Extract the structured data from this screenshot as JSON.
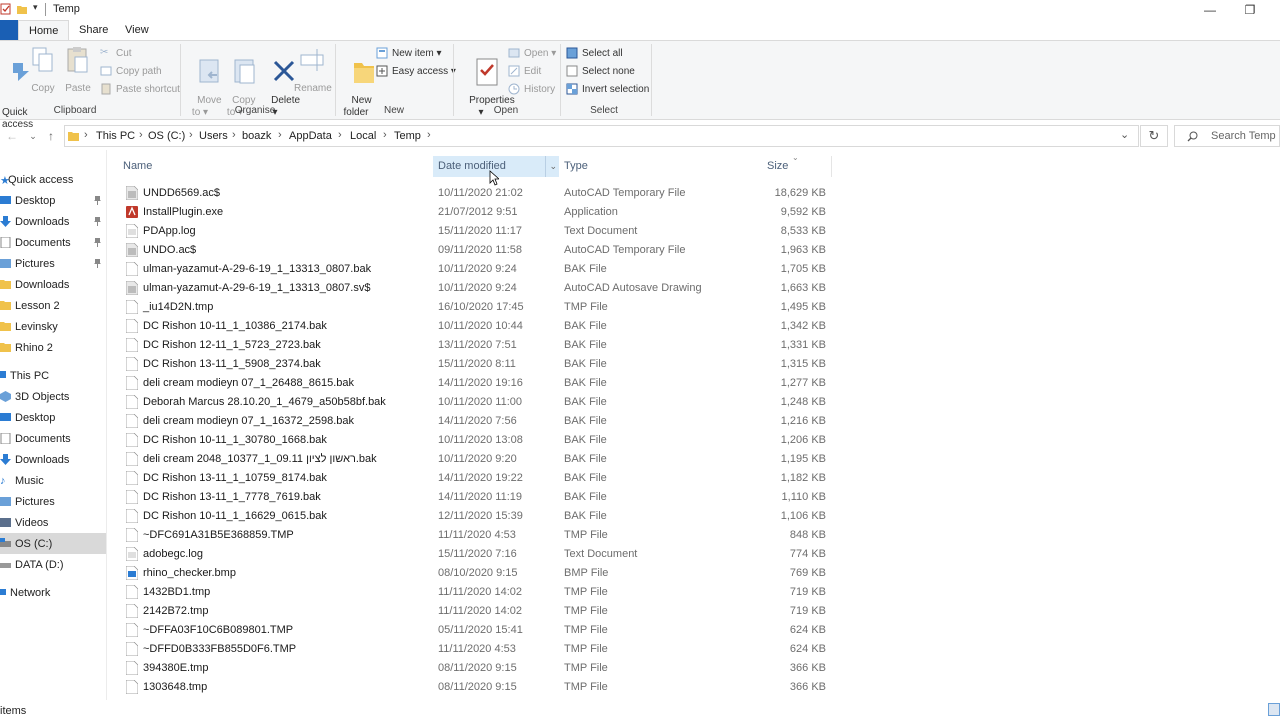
{
  "window": {
    "title": "Temp",
    "controls": [
      "—",
      "❐"
    ]
  },
  "tabs": [
    "Home",
    "Share",
    "View"
  ],
  "ribbon": {
    "clipboard": {
      "label": "Clipboard",
      "quick_access": "Quick\naccess",
      "copy": "Copy",
      "paste": "Paste",
      "cut": "Cut",
      "copy_path": "Copy path",
      "paste_shortcut": "Paste shortcut"
    },
    "organise": {
      "label": "Organise",
      "move_to": "Move\nto ▾",
      "copy_to": "Copy\nto ▾",
      "delete": "Delete\n▾",
      "rename": "Rename"
    },
    "new": {
      "label": "New",
      "new_folder": "New\nfolder",
      "new_item": "New item ▾",
      "easy_access": "Easy access ▾"
    },
    "open": {
      "label": "Open",
      "properties": "Properties\n▾",
      "open": "Open ▾",
      "edit": "Edit",
      "history": "History"
    },
    "select": {
      "label": "Select",
      "select_all": "Select all",
      "select_none": "Select none",
      "invert_selection": "Invert selection"
    }
  },
  "address": {
    "crumbs": [
      "This PC",
      "OS (C:)",
      "Users",
      "boazk",
      "AppData",
      "Local",
      "Temp"
    ],
    "separator": "›",
    "search_placeholder": "Search Temp"
  },
  "nav": {
    "quick_access": "Quick access",
    "pinned": [
      "Desktop",
      "Downloads",
      "Documents",
      "Pictures"
    ],
    "recent": [
      "Downloads",
      "Lesson 2",
      "Levinsky",
      "Rhino 2"
    ],
    "this_pc": "This PC",
    "pc_items": [
      "3D Objects",
      "Desktop",
      "Documents",
      "Downloads",
      "Music",
      "Pictures",
      "Videos",
      "OS (C:)",
      "DATA (D:)"
    ],
    "network": "Network"
  },
  "columns": {
    "name": "Name",
    "date": "Date modified",
    "type": "Type",
    "size": "Size"
  },
  "files": [
    {
      "name": "UNDD6569.ac$",
      "date": "10/11/2020 21:02",
      "type": "AutoCAD Temporary File",
      "size": "18,629 KB",
      "icon": "acad"
    },
    {
      "name": "InstallPlugin.exe",
      "date": "21/07/2012 9:51",
      "type": "Application",
      "size": "9,592 KB",
      "icon": "exe"
    },
    {
      "name": "PDApp.log",
      "date": "15/11/2020 11:17",
      "type": "Text Document",
      "size": "8,533 KB",
      "icon": "text"
    },
    {
      "name": "UNDO.ac$",
      "date": "09/11/2020 11:58",
      "type": "AutoCAD Temporary File",
      "size": "1,963 KB",
      "icon": "acad"
    },
    {
      "name": "ulman-yazamut-A-29-6-19_1_13313_0807.bak",
      "date": "10/11/2020 9:24",
      "type": "BAK File",
      "size": "1,705 KB",
      "icon": "blank"
    },
    {
      "name": "ulman-yazamut-A-29-6-19_1_13313_0807.sv$",
      "date": "10/11/2020 9:24",
      "type": "AutoCAD Autosave Drawing",
      "size": "1,663 KB",
      "icon": "acad"
    },
    {
      "name": "_iu14D2N.tmp",
      "date": "16/10/2020 17:45",
      "type": "TMP File",
      "size": "1,495 KB",
      "icon": "blank"
    },
    {
      "name": "DC Rishon 10-11_1_10386_2174.bak",
      "date": "10/11/2020 10:44",
      "type": "BAK File",
      "size": "1,342 KB",
      "icon": "blank"
    },
    {
      "name": "DC Rishon 12-11_1_5723_2723.bak",
      "date": "13/11/2020 7:51",
      "type": "BAK File",
      "size": "1,331 KB",
      "icon": "blank"
    },
    {
      "name": "DC Rishon 13-11_1_5908_2374.bak",
      "date": "15/11/2020 8:11",
      "type": "BAK File",
      "size": "1,315 KB",
      "icon": "blank"
    },
    {
      "name": "deli cream modieyn 07_1_26488_8615.bak",
      "date": "14/11/2020 19:16",
      "type": "BAK File",
      "size": "1,277 KB",
      "icon": "blank"
    },
    {
      "name": "Deborah Marcus 28.10.20_1_4679_a50b58bf.bak",
      "date": "10/11/2020 11:00",
      "type": "BAK File",
      "size": "1,248 KB",
      "icon": "blank"
    },
    {
      "name": "deli cream modieyn 07_1_16372_2598.bak",
      "date": "14/11/2020 7:56",
      "type": "BAK File",
      "size": "1,216 KB",
      "icon": "blank"
    },
    {
      "name": "DC Rishon 10-11_1_30780_1668.bak",
      "date": "10/11/2020 13:08",
      "type": "BAK File",
      "size": "1,206 KB",
      "icon": "blank"
    },
    {
      "name": "deli cream 2048_10377_1_09.11 ראשון לציון.bak",
      "date": "10/11/2020 9:20",
      "type": "BAK File",
      "size": "1,195 KB",
      "icon": "blank"
    },
    {
      "name": "DC Rishon 13-11_1_10759_8174.bak",
      "date": "14/11/2020 19:22",
      "type": "BAK File",
      "size": "1,182 KB",
      "icon": "blank"
    },
    {
      "name": "DC Rishon 13-11_1_7778_7619.bak",
      "date": "14/11/2020 11:19",
      "type": "BAK File",
      "size": "1,110 KB",
      "icon": "blank"
    },
    {
      "name": "DC Rishon 10-11_1_16629_0615.bak",
      "date": "12/11/2020 15:39",
      "type": "BAK File",
      "size": "1,106 KB",
      "icon": "blank"
    },
    {
      "name": "~DFC691A31B5E368859.TMP",
      "date": "11/11/2020 4:53",
      "type": "TMP File",
      "size": "848 KB",
      "icon": "blank"
    },
    {
      "name": "adobegc.log",
      "date": "15/11/2020 7:16",
      "type": "Text Document",
      "size": "774 KB",
      "icon": "text"
    },
    {
      "name": "rhino_checker.bmp",
      "date": "08/10/2020 9:15",
      "type": "BMP File",
      "size": "769 KB",
      "icon": "bmp"
    },
    {
      "name": "1432BD1.tmp",
      "date": "11/11/2020 14:02",
      "type": "TMP File",
      "size": "719 KB",
      "icon": "blank"
    },
    {
      "name": "2142B72.tmp",
      "date": "11/11/2020 14:02",
      "type": "TMP File",
      "size": "719 KB",
      "icon": "blank"
    },
    {
      "name": "~DFFA03F10C6B089801.TMP",
      "date": "05/11/2020 15:41",
      "type": "TMP File",
      "size": "624 KB",
      "icon": "blank"
    },
    {
      "name": "~DFFD0B333FB855D0F6.TMP",
      "date": "11/11/2020 4:53",
      "type": "TMP File",
      "size": "624 KB",
      "icon": "blank"
    },
    {
      "name": "394380E.tmp",
      "date": "08/11/2020 9:15",
      "type": "TMP File",
      "size": "366 KB",
      "icon": "blank"
    },
    {
      "name": "1303648.tmp",
      "date": "08/11/2020 9:15",
      "type": "TMP File",
      "size": "366 KB",
      "icon": "blank"
    }
  ],
  "status": {
    "text": "items"
  },
  "colors": {
    "accent": "#1a5fb4",
    "selected_column": "#d9ebf9",
    "nav_selected": "#d9d9d9",
    "folder": "#f0c24b"
  }
}
